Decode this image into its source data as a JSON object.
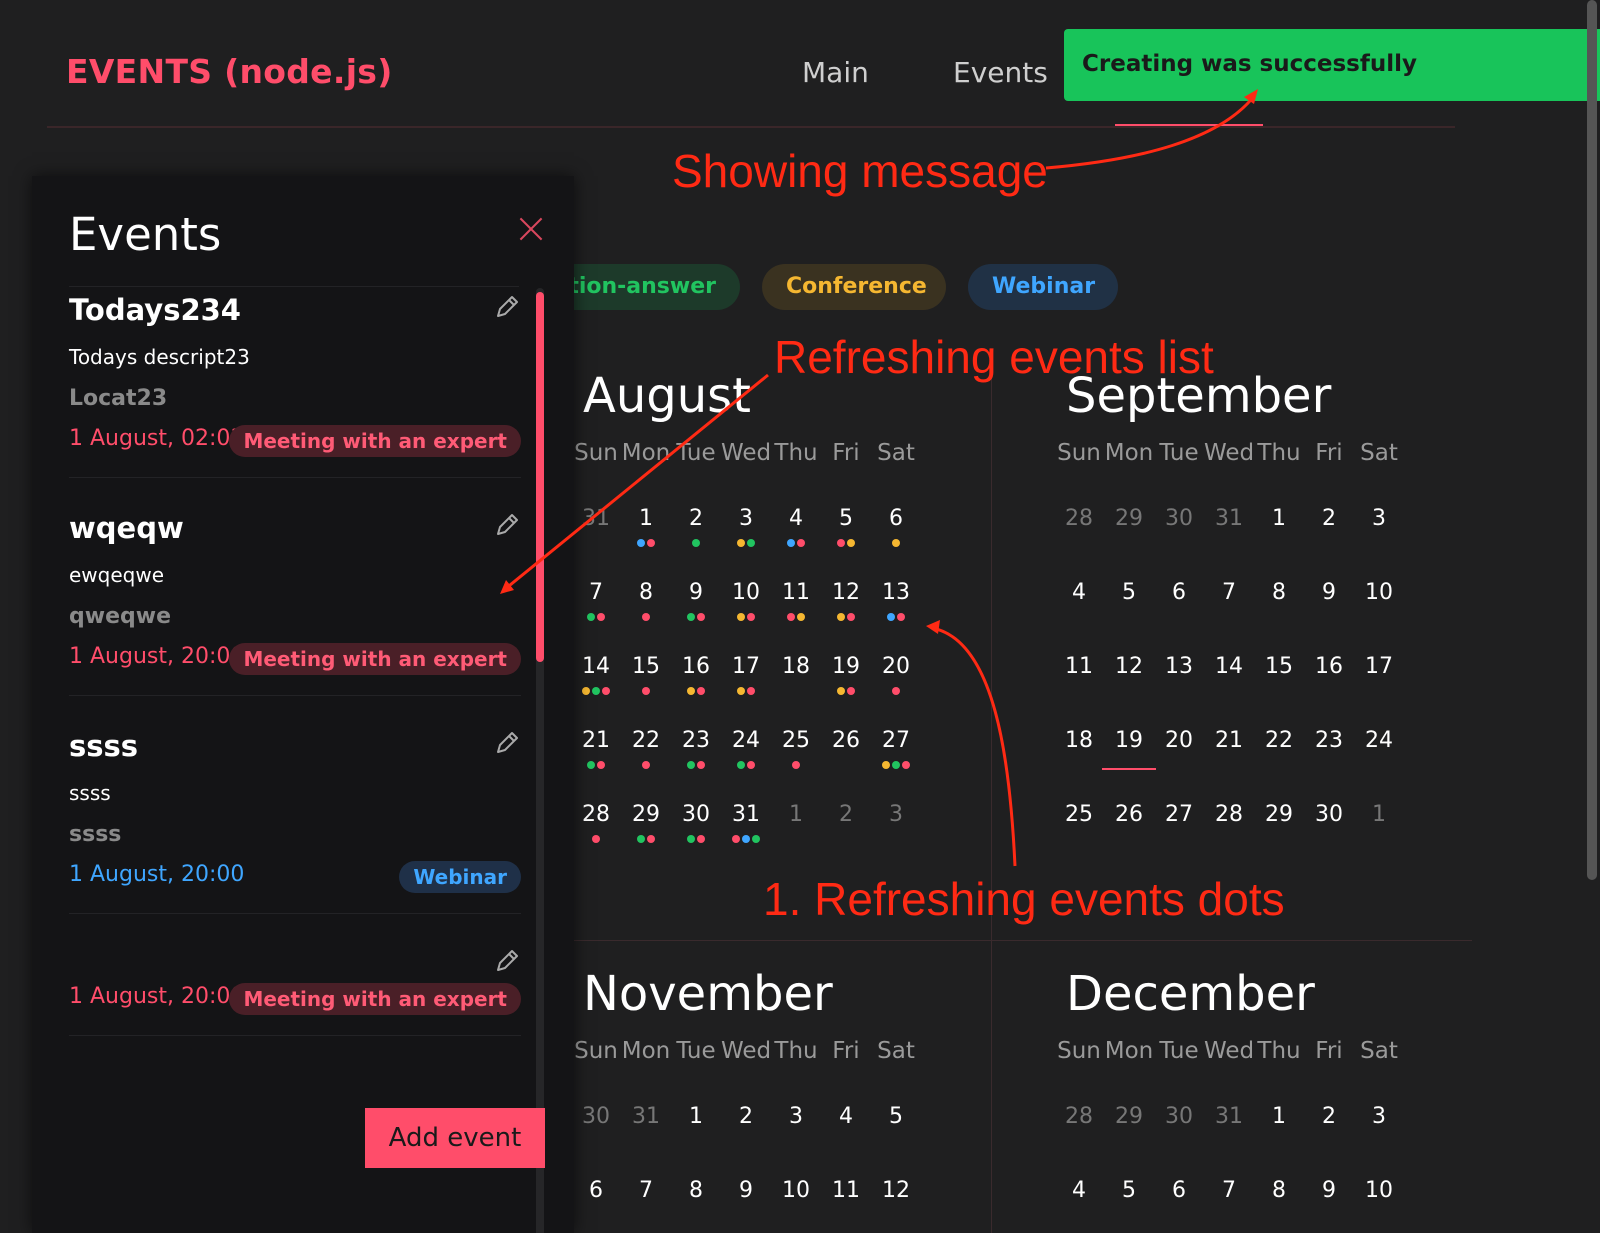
{
  "header": {
    "logo": "EVENTS (node.js)",
    "nav": [
      "Main",
      "Events"
    ]
  },
  "toast": {
    "message": "Creating was successfully",
    "color": "#18c45a"
  },
  "chips": [
    {
      "label": "tion-answer",
      "color": "#21c460"
    },
    {
      "label": "Conference",
      "color": "#f5b731"
    },
    {
      "label": "Webinar",
      "color": "#3fa6ff"
    }
  ],
  "weekdays": [
    "Sun",
    "Mon",
    "Tue",
    "Wed",
    "Thu",
    "Fri",
    "Sat"
  ],
  "colors": {
    "accent": "#ff4d6a",
    "pink": "#ff4d6a",
    "green": "#21c460",
    "yellow": "#f5b731",
    "blue": "#3fa6ff"
  },
  "calendar": {
    "august": {
      "name": "August",
      "weeks": [
        [
          "31",
          "1",
          "2",
          "3",
          "4",
          "5",
          "6"
        ],
        [
          "7",
          "8",
          "9",
          "10",
          "11",
          "12",
          "13"
        ],
        [
          "14",
          "15",
          "16",
          "17",
          "18",
          "19",
          "20"
        ],
        [
          "21",
          "22",
          "23",
          "24",
          "25",
          "26",
          "27"
        ],
        [
          "28",
          "29",
          "30",
          "31",
          "1",
          "2",
          "3"
        ]
      ],
      "muted": [
        [
          0,
          0
        ],
        [
          4,
          4
        ],
        [
          4,
          5
        ],
        [
          4,
          6
        ]
      ],
      "dots": [
        [
          [],
          [
            "blue",
            "pink"
          ],
          [
            "green"
          ],
          [
            "yellow",
            "green"
          ],
          [
            "blue",
            "pink"
          ],
          [
            "pink",
            "yellow"
          ],
          [
            "yellow"
          ]
        ],
        [
          [
            "green",
            "pink"
          ],
          [
            "pink"
          ],
          [
            "green",
            "pink"
          ],
          [
            "yellow",
            "pink"
          ],
          [
            "pink",
            "yellow"
          ],
          [
            "yellow",
            "pink"
          ],
          [
            "blue",
            "pink"
          ]
        ],
        [
          [
            "yellow",
            "green",
            "pink"
          ],
          [
            "pink"
          ],
          [
            "yellow",
            "pink"
          ],
          [
            "yellow",
            "pink"
          ],
          [],
          [
            "yellow",
            "pink"
          ],
          [
            "pink"
          ]
        ],
        [
          [
            "green",
            "pink"
          ],
          [
            "pink"
          ],
          [
            "green",
            "pink"
          ],
          [
            "green",
            "pink"
          ],
          [
            "pink"
          ],
          [],
          [
            "yellow",
            "green",
            "pink"
          ]
        ],
        [
          [
            "pink"
          ],
          [
            "green",
            "pink"
          ],
          [
            "green",
            "pink"
          ],
          [
            "pink",
            "blue",
            "green"
          ],
          [],
          [],
          []
        ]
      ]
    },
    "september": {
      "name": "September",
      "weeks": [
        [
          "28",
          "29",
          "30",
          "31",
          "1",
          "2",
          "3"
        ],
        [
          "4",
          "5",
          "6",
          "7",
          "8",
          "9",
          "10"
        ],
        [
          "11",
          "12",
          "13",
          "14",
          "15",
          "16",
          "17"
        ],
        [
          "18",
          "19",
          "20",
          "21",
          "22",
          "23",
          "24"
        ],
        [
          "25",
          "26",
          "27",
          "28",
          "29",
          "30",
          "1"
        ]
      ],
      "muted": [
        [
          0,
          0
        ],
        [
          0,
          1
        ],
        [
          0,
          2
        ],
        [
          0,
          3
        ],
        [
          4,
          6
        ]
      ],
      "today": [
        3,
        1
      ]
    },
    "november": {
      "name": "November",
      "weeks": [
        [
          "30",
          "31",
          "1",
          "2",
          "3",
          "4",
          "5"
        ],
        [
          "6",
          "7",
          "8",
          "9",
          "10",
          "11",
          "12"
        ]
      ],
      "muted": [
        [
          0,
          0
        ],
        [
          0,
          1
        ]
      ]
    },
    "december": {
      "name": "December",
      "weeks": [
        [
          "28",
          "29",
          "30",
          "31",
          "1",
          "2",
          "3"
        ],
        [
          "4",
          "5",
          "6",
          "7",
          "8",
          "9",
          "10"
        ]
      ],
      "muted": [
        [
          0,
          0
        ],
        [
          0,
          1
        ],
        [
          0,
          2
        ],
        [
          0,
          3
        ]
      ]
    }
  },
  "panel": {
    "title": "Events",
    "add_button": "Add event",
    "events": [
      {
        "title": "Todays234",
        "description": "Todays descript23",
        "location": "Locat23",
        "date": "1 August, 02:03",
        "type": "Meeting with an expert",
        "kind": "meet"
      },
      {
        "title": "wqeqw",
        "description": "ewqeqwe",
        "location": "qweqwe",
        "date": "1 August, 20:00",
        "type": "Meeting with an expert",
        "kind": "meet"
      },
      {
        "title": "ssss",
        "description": "ssss",
        "location": "ssss",
        "date": "1 August, 20:00",
        "type": "Webinar",
        "kind": "web"
      },
      {
        "title": "",
        "description": "",
        "location": "",
        "date": "1 August, 20:00",
        "type": "Meeting with an expert",
        "kind": "meet"
      }
    ]
  },
  "annotations": {
    "showing_message": "Showing message",
    "refreshing_list": "Refreshing events list",
    "refreshing_dots": "1. Refreshing events dots"
  }
}
